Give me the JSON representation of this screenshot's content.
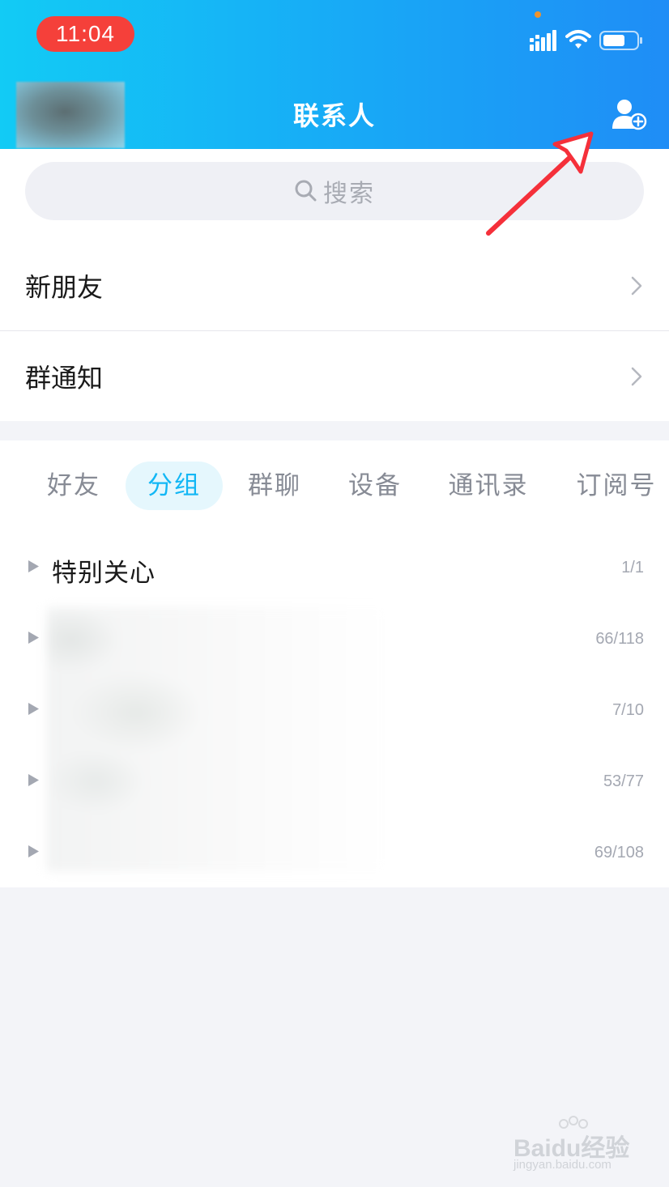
{
  "status_bar": {
    "time": "11:04"
  },
  "header": {
    "title": "联系人"
  },
  "search": {
    "placeholder": "搜索"
  },
  "list": {
    "new_friends": "新朋友",
    "group_notice": "群通知"
  },
  "tabs": [
    {
      "label": "好友",
      "active": false
    },
    {
      "label": "分组",
      "active": true
    },
    {
      "label": "群聊",
      "active": false
    },
    {
      "label": "设备",
      "active": false
    },
    {
      "label": "通讯录",
      "active": false
    },
    {
      "label": "订阅号",
      "active": false
    }
  ],
  "groups": [
    {
      "name": "特别关心",
      "count": "1/1"
    },
    {
      "name": "",
      "count": "66/118"
    },
    {
      "name": "",
      "count": "7/10"
    },
    {
      "name": "",
      "count": "53/77"
    },
    {
      "name": "",
      "count": "69/108"
    }
  ],
  "watermark": {
    "text": "Baidu经验",
    "sub": "jingyan.baidu.com"
  },
  "colors": {
    "accent": "#12b7f5",
    "time_pill": "#f5403a",
    "arrow": "#f5303a"
  }
}
